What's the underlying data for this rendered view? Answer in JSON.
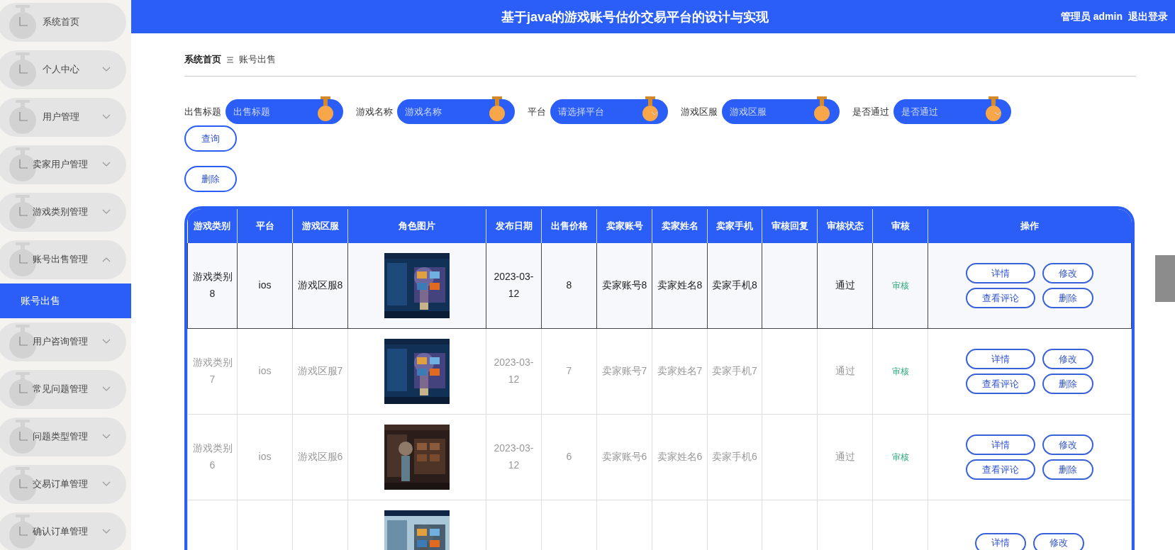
{
  "header": {
    "title": "基于java的游戏账号估价交易平台的设计与实现",
    "user": "管理员 admin",
    "logout": "退出登录"
  },
  "sidebar": {
    "items": [
      {
        "label": "系统首页",
        "expandable": false
      },
      {
        "label": "个人中心",
        "expandable": true,
        "expanded": false
      },
      {
        "label": "用户管理",
        "expandable": true,
        "expanded": false
      },
      {
        "label": "卖家用户管理",
        "expandable": true,
        "expanded": false
      },
      {
        "label": "游戏类别管理",
        "expandable": true,
        "expanded": false
      },
      {
        "label": "账号出售管理",
        "expandable": true,
        "expanded": true,
        "children": [
          {
            "label": "账号出售",
            "selected": true
          }
        ]
      },
      {
        "label": "用户咨询管理",
        "expandable": true,
        "expanded": false
      },
      {
        "label": "常见问题管理",
        "expandable": true,
        "expanded": false
      },
      {
        "label": "问题类型管理",
        "expandable": true,
        "expanded": false
      },
      {
        "label": "交易订单管理",
        "expandable": true,
        "expanded": false
      },
      {
        "label": "确认订单管理",
        "expandable": true,
        "expanded": false
      }
    ]
  },
  "breadcrumb": [
    "系统首页",
    "账号出售"
  ],
  "filters": [
    {
      "label": "出售标题",
      "placeholder": "出售标题",
      "kind": "input"
    },
    {
      "label": "游戏名称",
      "placeholder": "游戏名称",
      "kind": "input"
    },
    {
      "label": "平台",
      "placeholder": "请选择平台",
      "kind": "select"
    },
    {
      "label": "游戏区服",
      "placeholder": "游戏区服",
      "kind": "input"
    },
    {
      "label": "是否通过",
      "placeholder": "是否通过",
      "kind": "select"
    }
  ],
  "search_button": "查询",
  "delete_button": "删除",
  "table": {
    "columns": [
      "游戏类别",
      "平台",
      "游戏区服",
      "角色图片",
      "发布日期",
      "出售价格",
      "卖家账号",
      "卖家姓名",
      "卖家手机",
      "审核回复",
      "审核状态",
      "审核",
      "操作"
    ],
    "rows": [
      {
        "selected": true,
        "category": "游戏类别8",
        "platform": "ios",
        "server": "游戏区服8",
        "picture": {
          "kind": "picture"
        },
        "date": "2023-03-12",
        "price": "8",
        "account": "卖家账号8",
        "name": "卖家姓名8",
        "phone": "卖家手机8",
        "status": "通过",
        "audit": "审核",
        "actions": [
          "详情",
          "修改",
          "查看评论",
          "删除"
        ]
      },
      {
        "selected": false,
        "category": "游戏类别7",
        "platform": "ios",
        "server": "游戏区服7",
        "picture": {
          "kind": "picture"
        },
        "date": "2023-03-12",
        "price": "7",
        "account": "卖家账号7",
        "name": "卖家姓名7",
        "phone": "卖家手机7",
        "status": "通过",
        "audit": "审核",
        "actions": [
          "详情",
          "修改",
          "查看评论",
          "删除"
        ]
      },
      {
        "selected": false,
        "category": "游戏类别6",
        "platform": "ios",
        "server": "游戏区服6",
        "picture": {
          "kind": "picture"
        },
        "date": "2023-03-12",
        "price": "6",
        "account": "卖家账号6",
        "name": "卖家姓名6",
        "phone": "卖家手机6",
        "status": "通过",
        "audit": "审核",
        "actions": [
          "详情",
          "修改",
          "查看评论",
          "删除"
        ]
      },
      {
        "selected": false,
        "picture": {
          "kind": "picture"
        },
        "actions": [
          "详情",
          "修改"
        ]
      }
    ]
  }
}
